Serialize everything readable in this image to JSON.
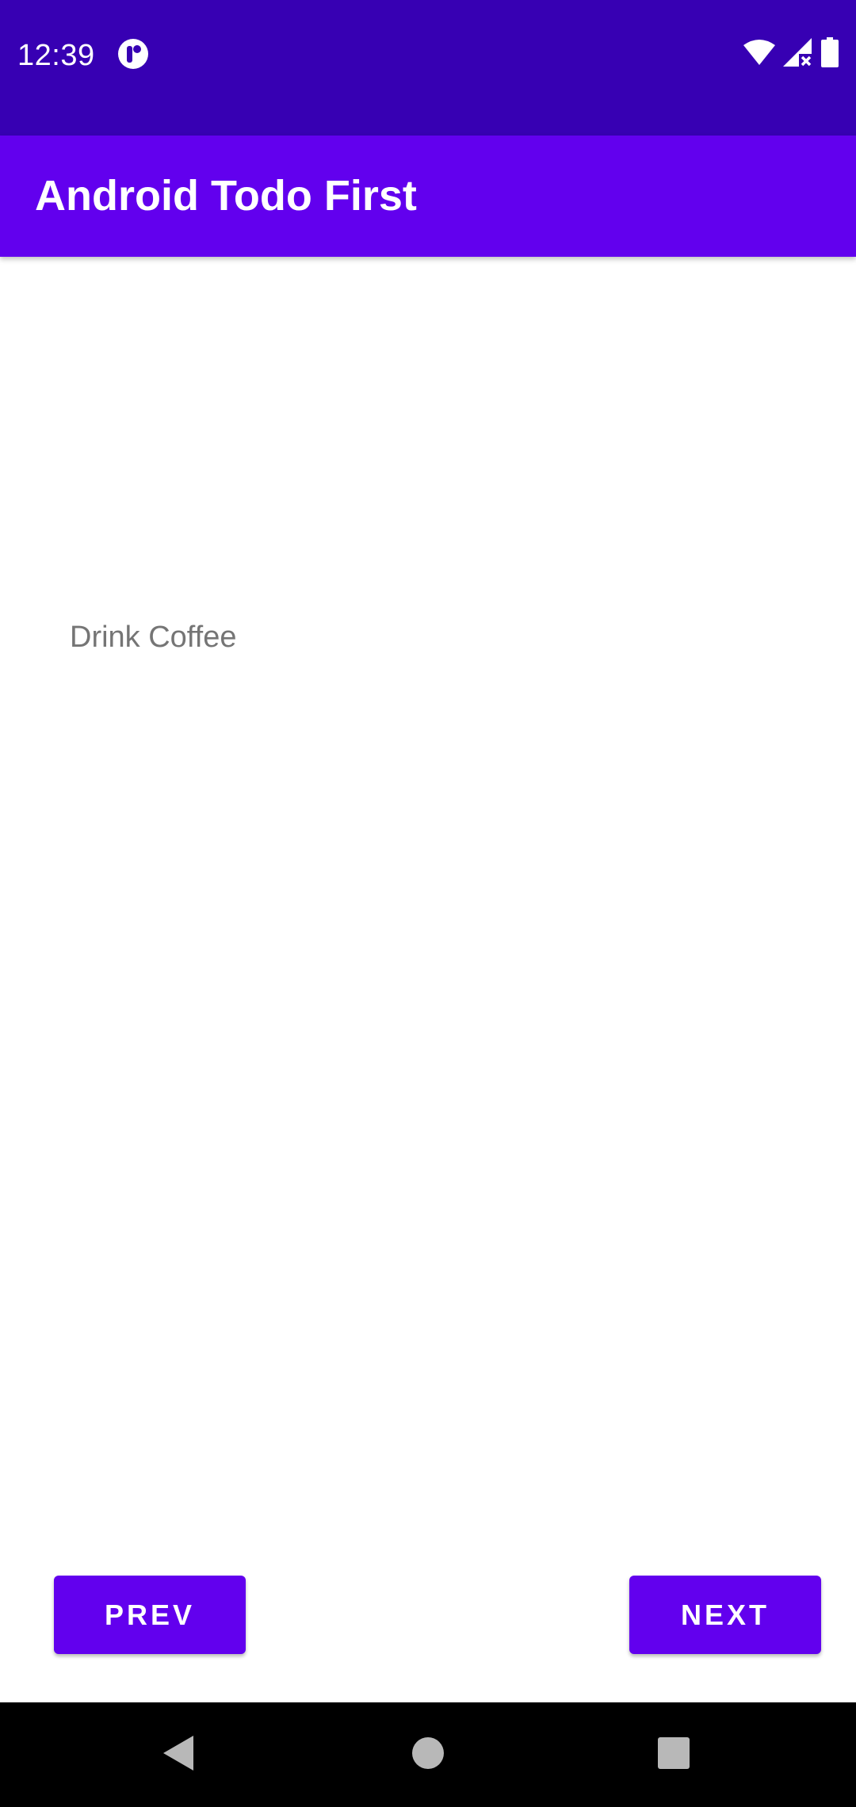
{
  "status_bar": {
    "time": "12:39",
    "app_icon": "notification-app-icon",
    "wifi_icon": "wifi-icon",
    "signal_icon": "cell-signal-no-service-icon",
    "battery_icon": "battery-icon"
  },
  "app_bar": {
    "title": "Android Todo First"
  },
  "content": {
    "todo_text": "Drink Coffee"
  },
  "buttons": {
    "prev_label": "PREV",
    "next_label": "NEXT"
  },
  "nav_bar": {
    "back_icon": "back-triangle-icon",
    "home_icon": "home-circle-icon",
    "recents_icon": "recents-square-icon"
  },
  "colors": {
    "status_bar": "#3700B3",
    "primary": "#6200EE",
    "text_secondary": "#757575",
    "nav_bar": "#000000"
  }
}
